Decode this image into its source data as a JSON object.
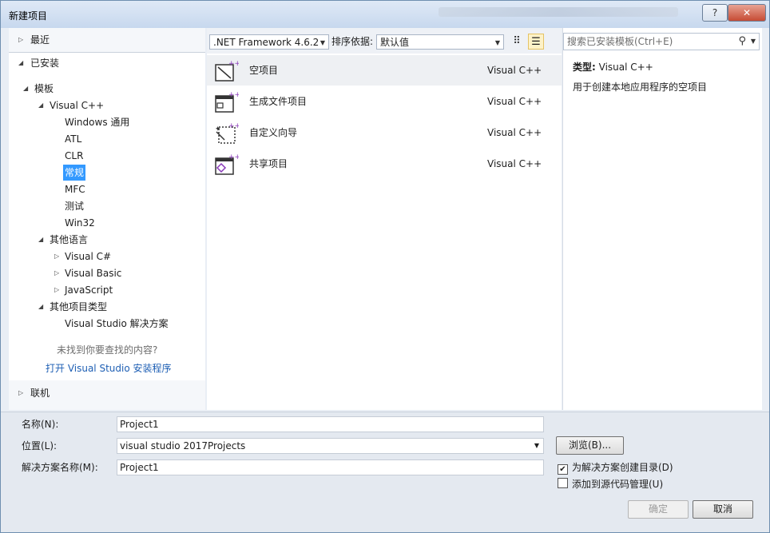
{
  "window": {
    "title": "新建项目",
    "help_label": "?",
    "close_label": "✕"
  },
  "left": {
    "recent": "最近",
    "installed": "已安装",
    "tree": {
      "templates": "模板",
      "visual_cpp": "Visual C++",
      "cpp_items": [
        "Windows 通用",
        "ATL",
        "CLR",
        "常规",
        "MFC",
        "测试",
        "Win32"
      ],
      "other_languages": "其他语言",
      "lang_items": [
        "Visual C#",
        "Visual Basic",
        "JavaScript"
      ],
      "other_project_types": "其他项目类型",
      "solution_item": "Visual Studio 解决方案",
      "not_found": "未找到你要查找的内容?",
      "open_installer": "打开 Visual Studio 安装程序"
    },
    "online": "联机"
  },
  "toolbar": {
    "framework": ".NET Framework 4.6.2",
    "sort_label": "排序依据:",
    "sort_value": "默认值"
  },
  "templates": [
    {
      "name": "空项目",
      "lang": "Visual C++"
    },
    {
      "name": "生成文件项目",
      "lang": "Visual C++"
    },
    {
      "name": "自定义向导",
      "lang": "Visual C++"
    },
    {
      "name": "共享项目",
      "lang": "Visual C++"
    }
  ],
  "search": {
    "placeholder": "搜索已安装模板(Ctrl+E)"
  },
  "info": {
    "type_label": "类型:",
    "type_value": "Visual C++",
    "description": "用于创建本地应用程序的空项目"
  },
  "form": {
    "name_label": "名称(N):",
    "name_value": "Project1",
    "location_label": "位置(L):",
    "location_value": "visual studio 2017Projects",
    "solution_label": "解决方案名称(M):",
    "solution_value": "Project1",
    "browse_label": "浏览(B)...",
    "create_dir_label": "为解决方案创建目录(D)",
    "create_dir_checked": "✔",
    "source_control_label": "添加到源代码管理(U)",
    "ok_label": "确定",
    "cancel_label": "取消"
  }
}
